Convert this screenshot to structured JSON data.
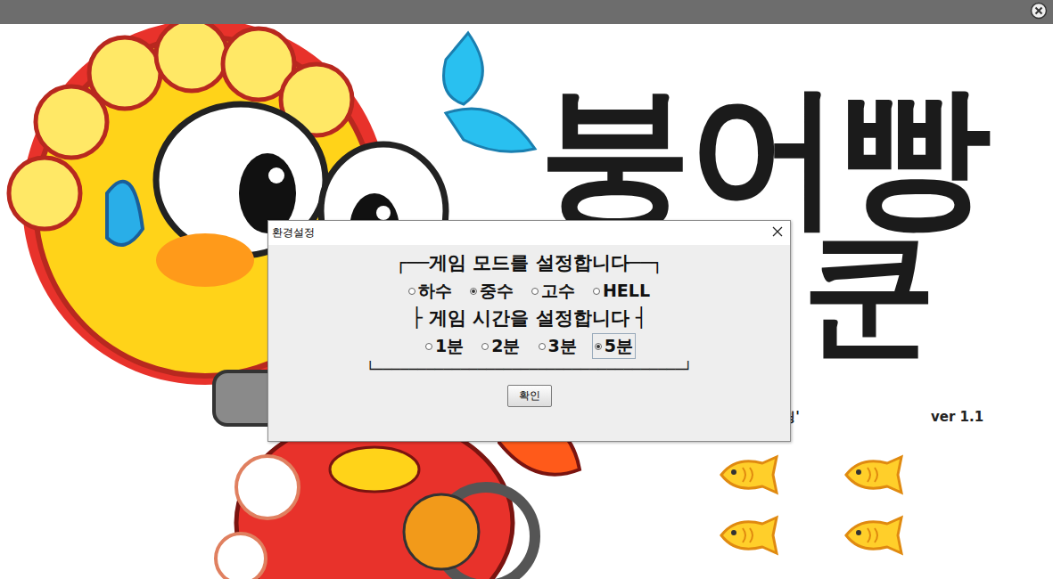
{
  "splash": {
    "title": "붕어빵",
    "title_cut": "쿤",
    "subtitle": "는 스윙'",
    "version": "ver 1.1"
  },
  "dialog": {
    "title": "환경설정",
    "mode_heading": "┌──게임 모드를 설정합니다──┐",
    "modes": [
      {
        "label": "하수",
        "selected": false
      },
      {
        "label": "중수",
        "selected": true
      },
      {
        "label": "고수",
        "selected": false
      },
      {
        "label": "HELL",
        "selected": false
      }
    ],
    "time_heading": "├   게임 시간을 설정합니다   ┤",
    "times": [
      {
        "label": "1분",
        "selected": false,
        "focused": false
      },
      {
        "label": "2분",
        "selected": false,
        "focused": false
      },
      {
        "label": "3분",
        "selected": false,
        "focused": false
      },
      {
        "label": "5분",
        "selected": true,
        "focused": true
      }
    ],
    "bottom_line": "└────────────────────────────────────┘",
    "buttons": [
      "확인"
    ]
  }
}
